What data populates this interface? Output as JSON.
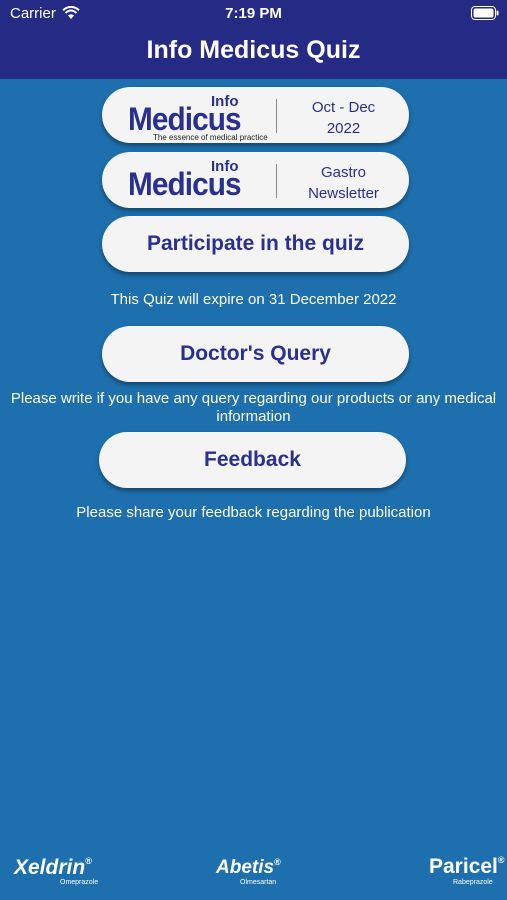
{
  "status": {
    "carrier": "Carrier",
    "time": "7:19 PM"
  },
  "header": {
    "title": "Info Medicus Quiz"
  },
  "issue_card": {
    "logo_info": "Info",
    "logo_name": "Medicus",
    "logo_tagline": "The essence of medical practice",
    "line1": "Oct - Dec",
    "line2": "2022"
  },
  "newsletter_card": {
    "logo_info": "Info",
    "logo_name": "Medicus",
    "line1": "Gastro",
    "line2": "Newsletter"
  },
  "quiz": {
    "button": "Participate in the quiz",
    "note": "This Quiz will expire on 31 December 2022"
  },
  "query": {
    "button": "Doctor's Query",
    "note": "Please write if you have any query regarding our products or any medical information"
  },
  "feedback": {
    "button": "Feedback",
    "note": "Please share your feedback regarding the publication"
  },
  "footer": {
    "brands": [
      {
        "name": "Xeldrin",
        "sub": "Omeprazole"
      },
      {
        "name": "Abetis",
        "sub": "Olmesartan"
      },
      {
        "name": "Paricel",
        "sub": "Rabeprazole"
      }
    ]
  },
  "colors": {
    "header": "#252a84",
    "background": "#1d6fae",
    "accent_text": "#2a3091",
    "button": "#f4f4f4"
  }
}
